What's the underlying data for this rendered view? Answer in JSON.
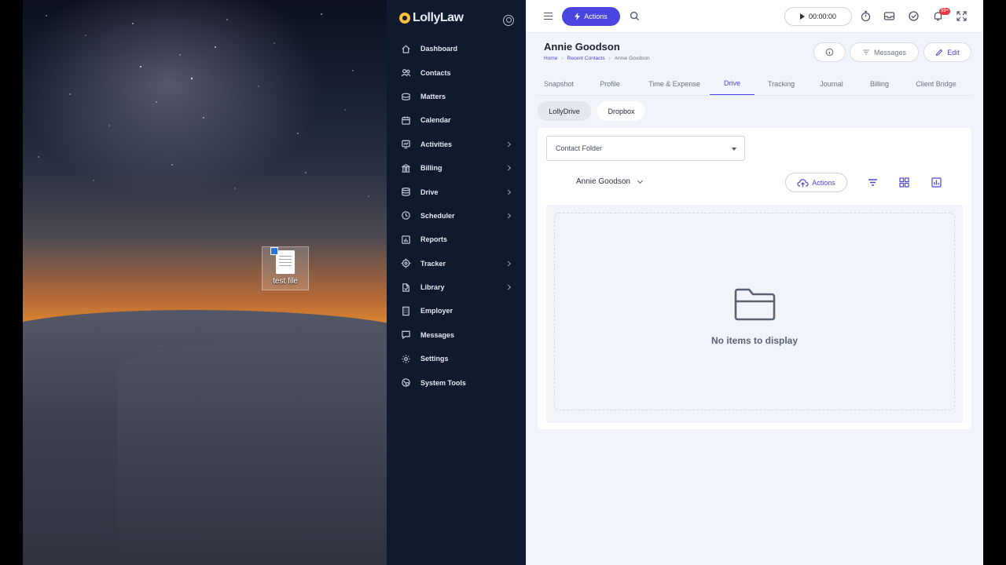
{
  "desktop": {
    "icon_label": "test file"
  },
  "app": {
    "brand": "LollyLaw"
  },
  "sidebar": {
    "items": [
      {
        "label": "Dashboard",
        "icon": "home-icon",
        "chevron": false
      },
      {
        "label": "Contacts",
        "icon": "users-icon",
        "chevron": false
      },
      {
        "label": "Matters",
        "icon": "briefcase-icon",
        "chevron": false
      },
      {
        "label": "Calendar",
        "icon": "calendar-icon",
        "chevron": false
      },
      {
        "label": "Activities",
        "icon": "activity-icon",
        "chevron": true
      },
      {
        "label": "Billing",
        "icon": "bank-icon",
        "chevron": true
      },
      {
        "label": "Drive",
        "icon": "database-icon",
        "chevron": true
      },
      {
        "label": "Scheduler",
        "icon": "clock-icon",
        "chevron": true
      },
      {
        "label": "Reports",
        "icon": "report-icon",
        "chevron": false
      },
      {
        "label": "Tracker",
        "icon": "target-icon",
        "chevron": true
      },
      {
        "label": "Library",
        "icon": "library-icon",
        "chevron": true
      },
      {
        "label": "Employer",
        "icon": "building-icon",
        "chevron": false
      },
      {
        "label": "Messages",
        "icon": "message-icon",
        "chevron": false
      },
      {
        "label": "Settings",
        "icon": "gear-icon",
        "chevron": false
      },
      {
        "label": "System Tools",
        "icon": "tools-icon",
        "chevron": false
      }
    ]
  },
  "topbar": {
    "actions_label": "Actions",
    "timer": "00:00:00",
    "notification_badge": "99+"
  },
  "contact": {
    "name": "Annie Goodson",
    "breadcrumb": [
      "Home",
      "Recent Contacts",
      "Annie Goodson"
    ],
    "messages_label": "Messages",
    "edit_label": "Edit"
  },
  "tabs": [
    "Snapshot",
    "Profile",
    "Time & Expense",
    "Drive",
    "Tracking",
    "Journal",
    "Billing",
    "Client Bridge"
  ],
  "active_tab": "Drive",
  "subtabs": [
    "LollyDrive",
    "Dropbox"
  ],
  "drive": {
    "folder_select": "Contact Folder",
    "current_folder": "Annie Goodson",
    "actions_label": "Actions",
    "empty_text": "No items to display"
  },
  "colors": {
    "accent": "#4a45e0",
    "sidebar_bg": "#0f1a2e",
    "badge": "#e63946"
  }
}
